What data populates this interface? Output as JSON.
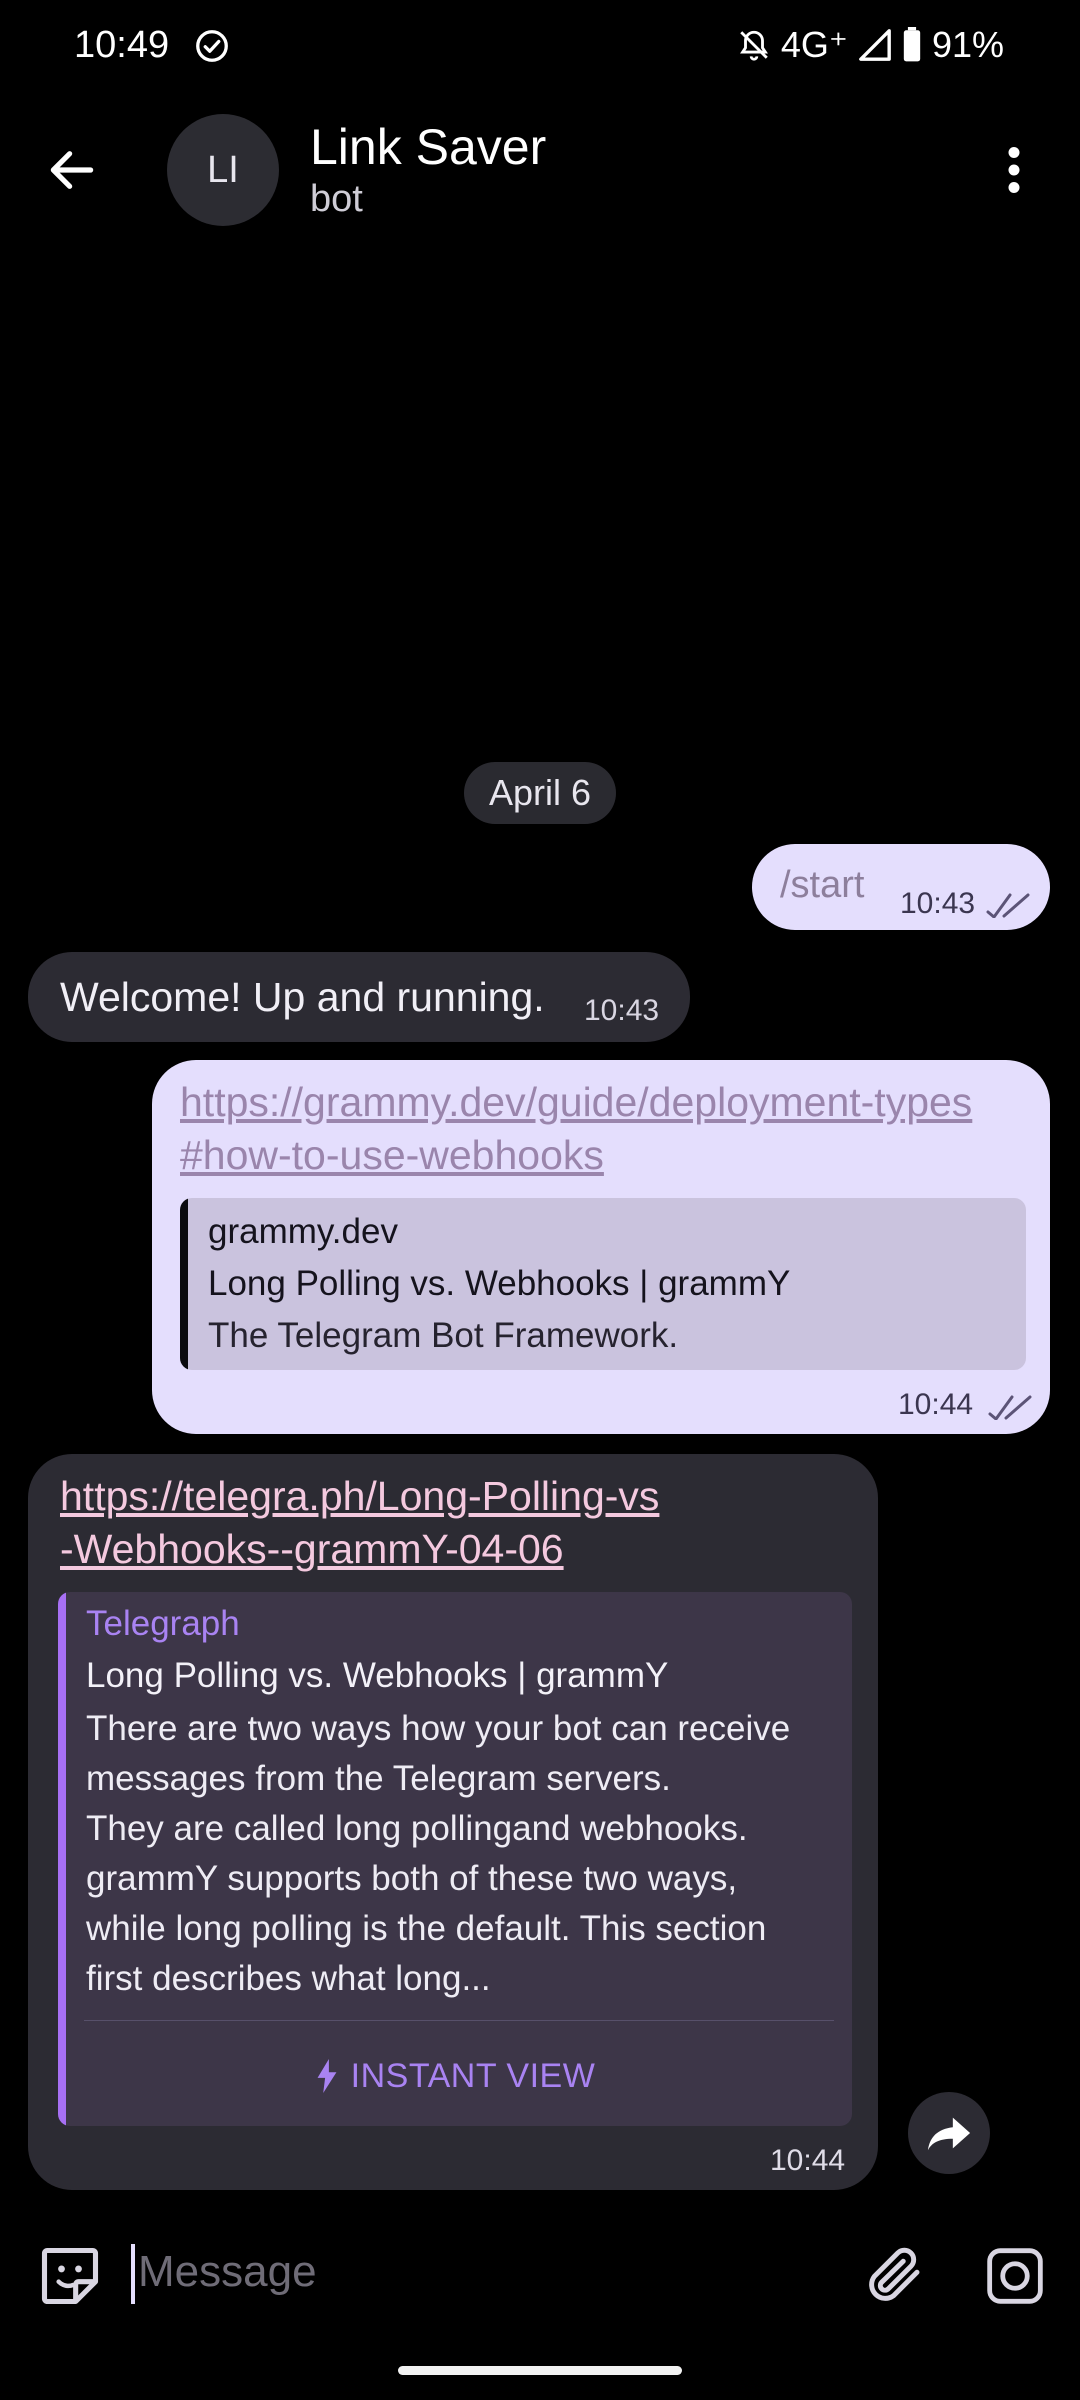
{
  "status_bar": {
    "time": "10:49",
    "network": "4G⁺",
    "battery": "91%"
  },
  "header": {
    "avatar_initials": "LI",
    "title": "Link Saver",
    "subtitle": "bot"
  },
  "date_separator": "April 6",
  "messages": [
    {
      "direction": "outgoing",
      "text": "/start",
      "time": "10:43",
      "status": "read"
    },
    {
      "direction": "incoming",
      "text": "Welcome! Up and running.",
      "time": "10:43"
    },
    {
      "direction": "outgoing",
      "link_lines": [
        "https://grammy.dev/guide/deployment-types",
        "#how-to-use-webhooks"
      ],
      "preview": {
        "site": "grammy.dev",
        "title": "Long Polling vs. Webhooks | grammY",
        "description": "The Telegram Bot Framework."
      },
      "time": "10:44",
      "status": "read"
    },
    {
      "direction": "incoming",
      "link_lines": [
        "https://telegra.ph/Long-Polling-vs",
        "-Webhooks--grammY-04-06"
      ],
      "preview": {
        "site": "Telegraph",
        "title": "Long Polling vs. Webhooks | grammY",
        "description_lines": [
          "There are two ways how your bot can receive",
          "messages from the Telegram servers.",
          "They are called long pollingand webhooks.",
          "grammY supports both of these two ways,",
          "while long polling is the default. This section",
          "first describes what long..."
        ],
        "button": "INSTANT VIEW"
      },
      "time": "10:44"
    }
  ],
  "input": {
    "placeholder": "Message"
  },
  "icons": [
    "back-arrow-icon",
    "more-vertical-icon",
    "double-check-icon",
    "lightning-icon",
    "share-icon",
    "sticker-icon",
    "paperclip-icon",
    "camera-icon"
  ],
  "colors": {
    "outgoing_bubble": "#e4defd",
    "incoming_bubble": "#2c2b33",
    "accent": "#a770f4"
  }
}
